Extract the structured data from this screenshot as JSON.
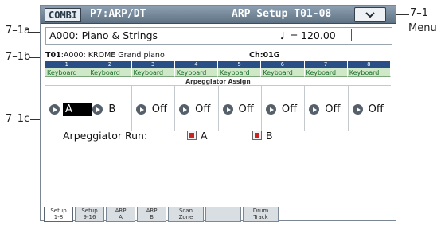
{
  "header": {
    "mode": "COMBI",
    "page": "P7:ARP/DT",
    "title": "ARP Setup T01-08",
    "menu_icon": "chevron-down-icon"
  },
  "program": {
    "name": "A000: Piano & Strings",
    "tempo_symbol": "♩",
    "tempo_eq": "=",
    "tempo_value": "120.00"
  },
  "timbre": {
    "id": "T01",
    "name": ":A000: KROME Grand piano",
    "channel": "Ch:01G"
  },
  "columns": [
    "1",
    "2",
    "3",
    "4",
    "5",
    "6",
    "7",
    "8"
  ],
  "keyboard": [
    "Keyboard",
    "Keyboard",
    "Keyboard",
    "Keyboard",
    "Keyboard",
    "Keyboard",
    "Keyboard",
    "Keyboard"
  ],
  "assign_label": "Arpeggiator Assign",
  "assign_values": [
    "A",
    "B",
    "Off",
    "Off",
    "Off",
    "Off",
    "Off",
    "Off"
  ],
  "run": {
    "label": "Arpeggiator Run:",
    "a": "A",
    "b": "B"
  },
  "tabs": [
    {
      "line1": "Setup",
      "line2": "1-8"
    },
    {
      "line1": "Setup",
      "line2": "9-16"
    },
    {
      "line1": "ARP",
      "line2": "A"
    },
    {
      "line1": "ARP",
      "line2": "B"
    },
    {
      "line1": "Scan",
      "line2": "Zone"
    },
    {
      "line1": "",
      "line2": ""
    },
    {
      "line1": "Drum",
      "line2": "Track"
    }
  ],
  "callouts": {
    "c1a": "7–1a",
    "c1b": "7–1b",
    "c1c": "7–1c",
    "c1": "7–1",
    "menu": "Menu"
  }
}
